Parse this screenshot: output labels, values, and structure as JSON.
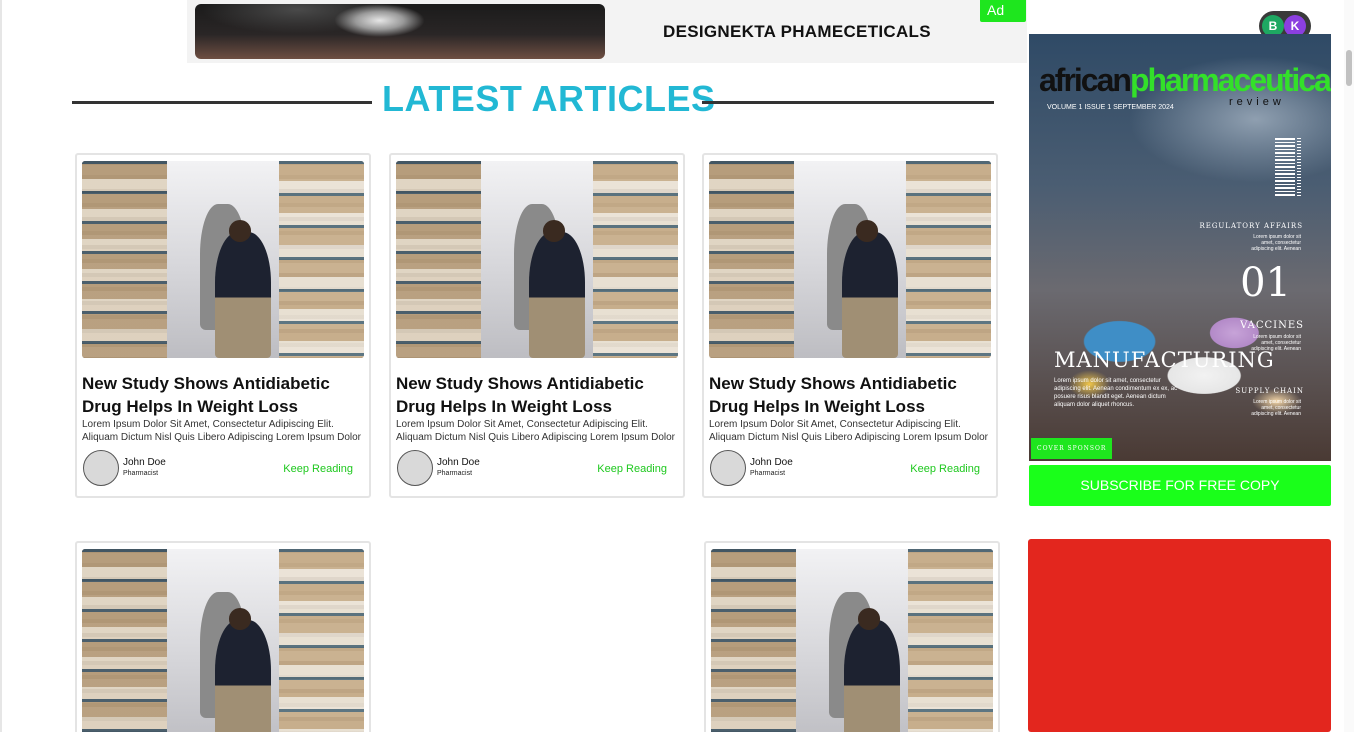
{
  "ad_banner": {
    "title": "DESIGNEKTA PHAMECETICALS",
    "tag": "Ad"
  },
  "section": {
    "heading": "LATEST ARTICLES"
  },
  "articles": [
    {
      "title": "New Study Shows Antidiabetic Drug Helps In Weight Loss",
      "excerpt": "Lorem Ipsum Dolor Sit Amet, Consectetur Adipiscing Elit. Aliquam Dictum Nisl Quis Libero Adipiscing Lorem Ipsum Dolor",
      "author": "John Doe",
      "role": "Pharmacist",
      "cta": "Keep Reading"
    },
    {
      "title": "New Study Shows Antidiabetic Drug Helps In Weight Loss",
      "excerpt": "Lorem Ipsum Dolor Sit Amet, Consectetur Adipiscing Elit. Aliquam Dictum Nisl Quis Libero Adipiscing Lorem Ipsum Dolor",
      "author": "John Doe",
      "role": "Pharmacist",
      "cta": "Keep Reading"
    },
    {
      "title": "New Study Shows Antidiabetic Drug Helps In Weight Loss",
      "excerpt": "Lorem Ipsum Dolor Sit Amet, Consectetur Adipiscing Elit. Aliquam Dictum Nisl Quis Libero Adipiscing Lorem Ipsum Dolor",
      "author": "John Doe",
      "role": "Pharmacist",
      "cta": "Keep Reading"
    }
  ],
  "user_avatars": [
    "B",
    "K"
  ],
  "magazine": {
    "logo_part1": "african",
    "logo_part2": "pharmaceutical",
    "logo_sub": "review",
    "volume": "VOLUME 1 ISSUE 1 SEPTEMBER 2024",
    "regulatory": "REGULATORY AFFAIRS",
    "regulatory_text": "Lorem ipsum dolor sit amet, consectetur adipiscing elit. Aenean",
    "number": "01",
    "vaccines": "VACCINES",
    "vaccines_text": "Lorem ipsum dolor sit amet, consectetur adipiscing elit. Aenean",
    "manufacturing": "MANUFACTURING",
    "manufacturing_text": "Lorem ipsum dolor sit amet, consectetur adipiscing elit. Aenean condimentum ex ex, ac posuere risus blandit eget. Aenean dictum aliquam dolor aliquet rhoncus.",
    "supply_chain": "SUPPLY CHAIN",
    "supply_text": "Lorem ipsum dolor sit amet, consectetur adipiscing elit. Aenean",
    "sponsor": "COVER SPONSOR"
  },
  "subscribe": {
    "label": "SUBSCRIBE FOR FREE COPY"
  },
  "colors": {
    "accent_cyan": "#22b8d4",
    "accent_green": "#1ee61e",
    "red_ad": "#e3261e"
  }
}
